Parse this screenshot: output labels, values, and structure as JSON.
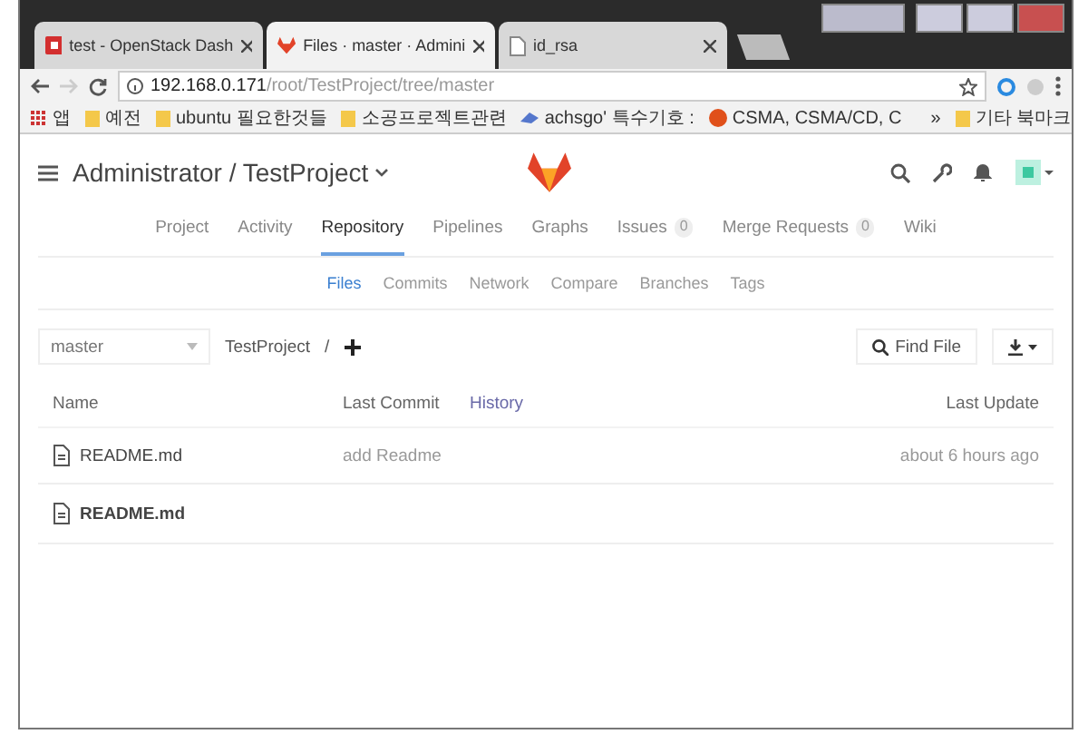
{
  "browser": {
    "tabs": [
      {
        "title": "test - OpenStack Dash",
        "kind": "openstack",
        "selected": false
      },
      {
        "title": "Files · master · Admini",
        "kind": "gitlab",
        "selected": true
      },
      {
        "title": "id_rsa",
        "kind": "file",
        "selected": false
      }
    ],
    "address": {
      "host": "192.168.0.171",
      "path": "/root/TestProject/tree/master"
    },
    "bookmarks": [
      {
        "label": "앱",
        "kind": "apps"
      },
      {
        "label": "예전",
        "kind": "folder"
      },
      {
        "label": "ubuntu 필요한것들",
        "kind": "folder"
      },
      {
        "label": "소공프로젝트관련",
        "kind": "folder"
      },
      {
        "label": "achsgo' 특수기호 :",
        "kind": "site"
      },
      {
        "label": "CSMA, CSMA/CD, C",
        "kind": "circle"
      }
    ],
    "bookmarks_more": "»",
    "other_bookmarks": "기타 북마크"
  },
  "header": {
    "title": "Administrator / TestProject"
  },
  "nav": [
    {
      "label": "Project",
      "selected": false
    },
    {
      "label": "Activity",
      "selected": false
    },
    {
      "label": "Repository",
      "selected": true
    },
    {
      "label": "Pipelines",
      "selected": false
    },
    {
      "label": "Graphs",
      "selected": false
    },
    {
      "label": "Issues",
      "count": "0",
      "selected": false
    },
    {
      "label": "Merge Requests",
      "count": "0",
      "selected": false
    },
    {
      "label": "Wiki",
      "selected": false
    }
  ],
  "subnav": [
    {
      "label": "Files",
      "selected": true
    },
    {
      "label": "Commits",
      "selected": false
    },
    {
      "label": "Network",
      "selected": false
    },
    {
      "label": "Compare",
      "selected": false
    },
    {
      "label": "Branches",
      "selected": false
    },
    {
      "label": "Tags",
      "selected": false
    }
  ],
  "toolbar": {
    "branch": "master",
    "breadcrumb": "TestProject",
    "separator": "/",
    "find_file": "Find File"
  },
  "table": {
    "columns": [
      "Name",
      "Last Commit",
      "History",
      "Last Update"
    ],
    "rows": [
      {
        "name": "README.md",
        "commit": "add Readme",
        "updated": "about 6 hours ago"
      }
    ]
  },
  "readme": {
    "title": "README.md"
  }
}
